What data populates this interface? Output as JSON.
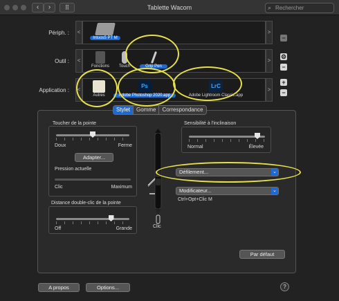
{
  "window": {
    "title": "Tablette Wacom",
    "search_placeholder": "Rechercher"
  },
  "toolbar": {
    "back_icon": "chevron-left-icon",
    "forward_icon": "chevron-right-icon",
    "grid_icon": "grid-icon"
  },
  "rows": {
    "peripheral": {
      "label": "Périph. :",
      "items": [
        {
          "caption": "Intuos5 PT M",
          "selected": true
        }
      ]
    },
    "tool": {
      "label": "Outil :",
      "items": [
        {
          "caption": "Fonctions",
          "selected": false
        },
        {
          "caption": "Touch",
          "selected": false
        },
        {
          "caption": "Grip Pen",
          "selected": true
        }
      ]
    },
    "application": {
      "label": "Application :",
      "items": [
        {
          "caption": "Autres",
          "selected": false
        },
        {
          "caption": "Adobe Photoshop 2020.app",
          "selected": true,
          "icon_text": "Ps"
        },
        {
          "caption": "Adobe Lightroom Classic.app",
          "selected": false,
          "icon_text": "LrC"
        }
      ]
    }
  },
  "side_buttons": {
    "minus": "−",
    "plus": "+"
  },
  "tabs": [
    {
      "label": "Stylet",
      "active": true
    },
    {
      "label": "Gomme",
      "active": false
    },
    {
      "label": "Correspondance",
      "active": false
    }
  ],
  "tip_feel": {
    "title": "Toucher de la pointe",
    "soft": "Doux",
    "firm": "Ferme",
    "adjust_button": "Adapter...",
    "current_pressure": "Pression actuelle",
    "click": "Clic",
    "max": "Maximum",
    "value_fraction": 0.5
  },
  "tilt": {
    "title": "Sensibilité à l'inclinaison",
    "normal": "Normal",
    "high": "Élevée",
    "value_fraction": 0.9
  },
  "double_click": {
    "title": "Distance double-clic de la pointe",
    "off": "Off",
    "large": "Grande",
    "value_fraction": 0.75
  },
  "pen": {
    "upper_button": "Défilement...",
    "lower_button": "Modificateur...",
    "lower_shortcut": "Ctrl+Opt+Clic M",
    "tip_label": "Clic"
  },
  "default_button": "Par défaut",
  "footer": {
    "about": "A propos",
    "options": "Options...",
    "help": "?"
  },
  "colors": {
    "accent": "#1f6ad1",
    "annotation": "#e8e04a"
  }
}
